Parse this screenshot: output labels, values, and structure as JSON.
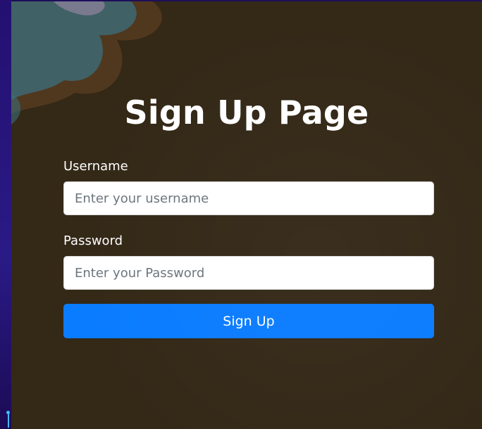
{
  "page": {
    "title": "Sign Up Page"
  },
  "form": {
    "username": {
      "label": "Username",
      "placeholder": "Enter your username",
      "value": ""
    },
    "password": {
      "label": "Password",
      "placeholder": "Enter your Password",
      "value": ""
    },
    "submit_label": "Sign Up"
  },
  "colors": {
    "panel_background": "#342817",
    "button_primary": "#0a7cff",
    "side_background": "#241070"
  }
}
